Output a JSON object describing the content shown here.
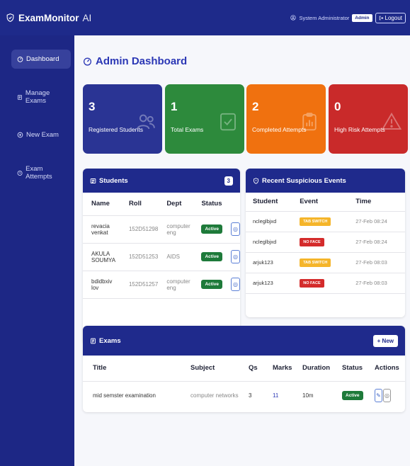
{
  "navbar": {
    "brand_bold": "ExamMonitor",
    "brand_light": "AI",
    "user": "System Administrator",
    "role": "Admin",
    "logout": "Logout"
  },
  "sidebar": {
    "items": [
      {
        "label": "Dashboard",
        "icon": "dashboard-icon",
        "active": true
      },
      {
        "label": "Manage Exams",
        "icon": "list-icon",
        "active": false
      },
      {
        "label": "New Exam",
        "icon": "plus-circle-icon",
        "active": false
      },
      {
        "label": "Exam Attempts",
        "icon": "clock-icon",
        "active": false
      }
    ]
  },
  "page": {
    "title": "Admin Dashboard"
  },
  "stats": [
    {
      "value": "3",
      "label": "Registered Students",
      "color": "#2a3494",
      "icon": "users-icon"
    },
    {
      "value": "1",
      "label": "Total Exams",
      "color": "#2d8a3c",
      "icon": "checklist-icon"
    },
    {
      "value": "2",
      "label": "Completed Attempts",
      "color": "#f0710f",
      "icon": "clipboard-chart-icon"
    },
    {
      "value": "0",
      "label": "High Risk Attempts",
      "color": "#c92a2a",
      "icon": "warning-icon"
    }
  ],
  "students": {
    "title": "Students",
    "count": "3",
    "columns": [
      "Name",
      "Roll",
      "Dept",
      "Status"
    ],
    "rows": [
      {
        "name": "revacia venkat",
        "roll": "152D51298",
        "dept": "computer eng",
        "status": "Active"
      },
      {
        "name": "AKULA SOUMYA",
        "roll": "152D51253",
        "dept": "AIDS",
        "status": "Active"
      },
      {
        "name": "bdidbxiv lov",
        "roll": "152D51257",
        "dept": "computer eng",
        "status": "Active"
      }
    ]
  },
  "events": {
    "title": "Recent Suspicious Events",
    "columns": [
      "Student",
      "Event",
      "Time"
    ],
    "rows": [
      {
        "student": "ncleglbjxd",
        "event": "TAB SWITCH",
        "type": "tab",
        "time": "27-Feb 08:24"
      },
      {
        "student": "ncleglbjxd",
        "event": "NO FACE",
        "type": "noface",
        "time": "27-Feb 08:24"
      },
      {
        "student": "arjuk123",
        "event": "TAB SWITCH",
        "type": "tab",
        "time": "27-Feb 08:03"
      },
      {
        "student": "arjuk123",
        "event": "NO FACE",
        "type": "noface",
        "time": "27-Feb 08:03"
      }
    ],
    "colors": {
      "tab": "#f5b52a",
      "noface": "#d42b2b"
    }
  },
  "exams": {
    "title": "Exams",
    "new_label": "+ New",
    "columns": [
      "Title",
      "Subject",
      "Qs",
      "Marks",
      "Duration",
      "Status",
      "Actions"
    ],
    "rows": [
      {
        "title": "mid semster examination",
        "subject": "computer networks",
        "qs": "3",
        "marks": "11",
        "duration": "10m",
        "status": "Active"
      }
    ]
  }
}
